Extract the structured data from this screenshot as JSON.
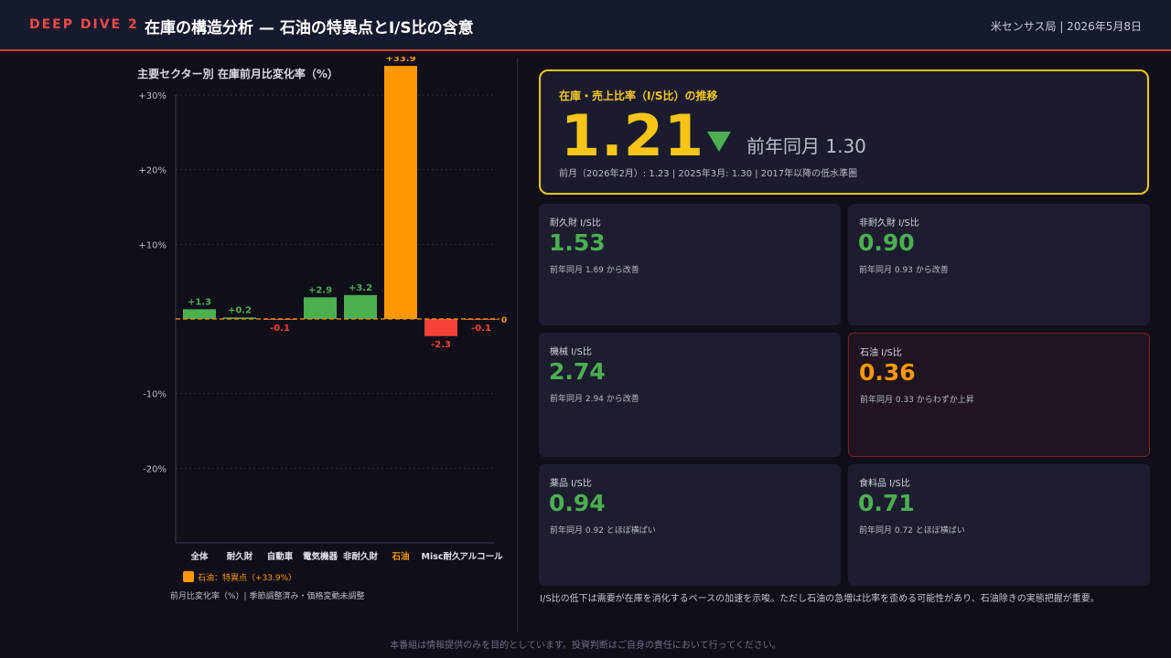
{
  "header": {
    "tag": "DEEP DIVE 2",
    "title": "在庫の構造分析 — 石油の特異点とI/S比の含意",
    "source": "米センサス局 | 2026年5月8日"
  },
  "chart_data": {
    "type": "bar",
    "title": "主要セクター別 在庫前月比変化率（%）",
    "categories": [
      "全体",
      "耐久財",
      "自動車",
      "電気機器",
      "非耐久財",
      "石油",
      "Misc耐久",
      "アルコール"
    ],
    "values": [
      1.3,
      0.2,
      -0.1,
      2.9,
      3.2,
      33.9,
      -2.3,
      -0.1
    ],
    "value_labels": [
      "+1.3",
      "+0.2",
      "-0.1",
      "+2.9",
      "+3.2",
      "+33.9",
      "-2.3",
      "-0.1"
    ],
    "y_ticks": [
      30,
      20,
      10,
      -10,
      -20
    ],
    "y_tick_labels": [
      "+30%",
      "+20%",
      "+10%",
      "-10%",
      "-20%"
    ],
    "zero_label": "0",
    "ylim": [
      -30,
      30
    ],
    "grid": true,
    "colors": {
      "positive": "#4caf50",
      "negative": "#f44336",
      "highlight": "#ff9800",
      "zero_line": "#ff9800"
    },
    "highlight_category": "石油",
    "legend": "石油：特異点（+33.9%）",
    "note": "前月比変化率（%）| 季節調整済み・価格変動未調整"
  },
  "kpi": {
    "label": "在庫・売上比率（I/S比）の推移",
    "value": "1.21",
    "direction": "down",
    "prev_year": "前年同月 1.30",
    "sub": "前月（2026年2月）: 1.23 | 2025年3月: 1.30 | 2017年以降の低水準圏",
    "accent": "#f5c518"
  },
  "cards": [
    {
      "label": "耐久財 I/S比",
      "value": "1.53",
      "note": "前年同月 1.69 から改善",
      "color": "#4caf50"
    },
    {
      "label": "非耐久財 I/S比",
      "value": "0.90",
      "note": "前年同月 0.93 から改善",
      "color": "#4caf50"
    },
    {
      "label": "機械 I/S比",
      "value": "2.74",
      "note": "前年同月 2.94 から改善",
      "color": "#4caf50"
    },
    {
      "label": "石油 I/S比",
      "value": "0.36",
      "note": "前年同月 0.33 からわずか上昇",
      "color": "#ff9800"
    },
    {
      "label": "薬品 I/S比",
      "value": "0.94",
      "note": "前年同月 0.92 とほぼ横ばい",
      "color": "#4caf50"
    },
    {
      "label": "食料品 I/S比",
      "value": "0.71",
      "note": "前年同月 0.72 とほぼ横ばい",
      "color": "#4caf50"
    }
  ],
  "right_note": "I/S比の低下は需要が在庫を消化するペースの加速を示唆。ただし石油の急増は比率を歪める可能性があり、石油除きの実態把握が重要。",
  "footer": "本番組は情報提供のみを目的としています。投資判断はご自身の責任において行ってください。"
}
